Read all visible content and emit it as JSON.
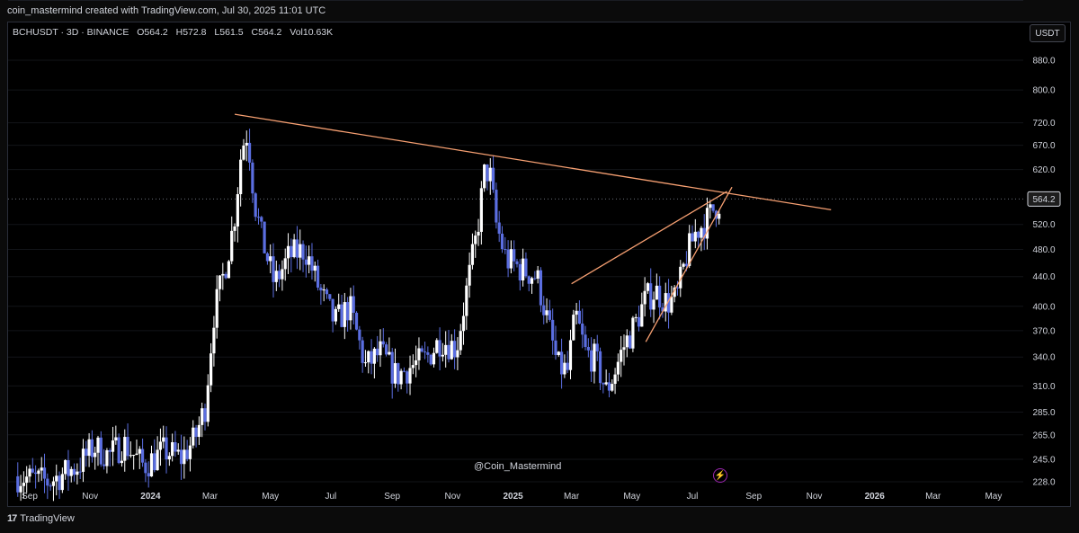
{
  "header": {
    "attribution": "coin_mastermind created with TradingView.com, Jul 30, 2025 11:01 UTC"
  },
  "legend": {
    "symbol": "BCHUSDT · 3D · BINANCE",
    "o_label": "O",
    "o_value": "564.2",
    "h_label": "H",
    "h_value": "572.8",
    "l_label": "L",
    "l_value": "561.5",
    "c_label": "C",
    "c_value": "564.2",
    "vol_label": "Vol",
    "vol_value": "10.63K"
  },
  "currency_button": "USDT",
  "price_tag": "564.2",
  "watermark": "@Coin_Mastermind",
  "footer": {
    "brand": "TradingView",
    "logo_glyph": "17"
  },
  "alert_icon": "lightning-icon",
  "colors": {
    "up": "#ffffff",
    "down": "#5b6ee1",
    "trendline": "#f7a072",
    "background": "#000000"
  },
  "chart_data": {
    "type": "candlestick",
    "symbol": "BCHUSDT",
    "timeframe": "3D",
    "exchange": "BINANCE",
    "current_price": 564.2,
    "y_scale": "log",
    "y_ticks": [
      880,
      800,
      720,
      670,
      620,
      564.2,
      520,
      480,
      440,
      400,
      370,
      340,
      310,
      285,
      265,
      245,
      228
    ],
    "y_tick_labels": [
      "880.0",
      "800.0",
      "720.0",
      "670.0",
      "620.0",
      "564.2",
      "520.0",
      "480.0",
      "440.0",
      "400.0",
      "370.0",
      "340.0",
      "310.0",
      "285.0",
      "265.0",
      "245.0",
      "228.0"
    ],
    "x_ticks": [
      "Sep",
      "Nov",
      "2024",
      "Mar",
      "May",
      "Jul",
      "Sep",
      "Nov",
      "2025",
      "Mar",
      "May",
      "Jul",
      "Sep",
      "Nov",
      "2026",
      "Mar",
      "May"
    ],
    "x_tick_dates": [
      "2023-09-01",
      "2023-11-01",
      "2024-01-01",
      "2024-03-01",
      "2024-05-01",
      "2024-07-01",
      "2024-09-01",
      "2024-11-01",
      "2025-01-01",
      "2025-03-01",
      "2025-05-01",
      "2025-07-01",
      "2025-09-01",
      "2025-11-01",
      "2026-01-01",
      "2026-03-01",
      "2026-05-01"
    ],
    "close_path": [
      [
        "2023-08-20",
        232
      ],
      [
        "2023-09-20",
        228
      ],
      [
        "2023-10-20",
        240
      ],
      [
        "2023-11-05",
        255
      ],
      [
        "2023-11-20",
        248
      ],
      [
        "2023-12-05",
        258
      ],
      [
        "2023-12-25",
        240
      ],
      [
        "2024-01-15",
        252
      ],
      [
        "2024-02-01",
        246
      ],
      [
        "2024-02-15",
        262
      ],
      [
        "2024-02-25",
        290
      ],
      [
        "2024-03-05",
        390
      ],
      [
        "2024-03-15",
        445
      ],
      [
        "2024-03-25",
        520
      ],
      [
        "2024-04-02",
        665
      ],
      [
        "2024-04-08",
        700
      ],
      [
        "2024-04-15",
        560
      ],
      [
        "2024-04-22",
        500
      ],
      [
        "2024-05-05",
        430
      ],
      [
        "2024-05-20",
        470
      ],
      [
        "2024-06-05",
        480
      ],
      [
        "2024-06-20",
        420
      ],
      [
        "2024-07-05",
        380
      ],
      [
        "2024-07-20",
        400
      ],
      [
        "2024-08-05",
        330
      ],
      [
        "2024-08-20",
        345
      ],
      [
        "2024-09-05",
        320
      ],
      [
        "2024-09-20",
        330
      ],
      [
        "2024-10-05",
        338
      ],
      [
        "2024-10-20",
        360
      ],
      [
        "2024-11-05",
        350
      ],
      [
        "2024-11-15",
        420
      ],
      [
        "2024-11-25",
        500
      ],
      [
        "2024-12-03",
        610
      ],
      [
        "2024-12-08",
        620
      ],
      [
        "2024-12-15",
        520
      ],
      [
        "2024-12-25",
        465
      ],
      [
        "2025-01-10",
        450
      ],
      [
        "2025-01-25",
        440
      ],
      [
        "2025-02-05",
        380
      ],
      [
        "2025-02-15",
        330
      ],
      [
        "2025-02-25",
        325
      ],
      [
        "2025-03-05",
        390
      ],
      [
        "2025-03-15",
        345
      ],
      [
        "2025-03-25",
        338
      ],
      [
        "2025-04-05",
        305
      ],
      [
        "2025-04-12",
        320
      ],
      [
        "2025-04-22",
        350
      ],
      [
        "2025-05-05",
        380
      ],
      [
        "2025-05-15",
        410
      ],
      [
        "2025-05-25",
        420
      ],
      [
        "2025-06-05",
        405
      ],
      [
        "2025-06-15",
        410
      ],
      [
        "2025-06-25",
        470
      ],
      [
        "2025-07-05",
        510
      ],
      [
        "2025-07-15",
        525
      ],
      [
        "2025-07-22",
        545
      ],
      [
        "2025-07-30",
        564.2
      ]
    ],
    "trendlines": [
      {
        "from": [
          "2024-03-26",
          740
        ],
        "to": [
          "2025-11-18",
          545
        ]
      },
      {
        "from": [
          "2025-03-01",
          430
        ],
        "to": [
          "2025-08-05",
          578
        ]
      },
      {
        "from": [
          "2025-05-15",
          357
        ],
        "to": [
          "2025-08-10",
          586
        ]
      }
    ]
  }
}
